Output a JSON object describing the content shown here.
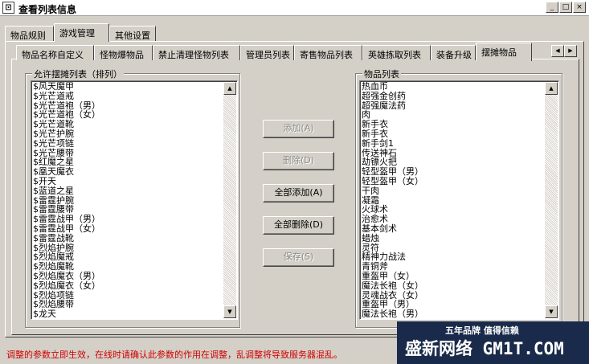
{
  "window": {
    "title": "查看列表信息",
    "icon": "app-window-icon",
    "minimize_glyph": "_",
    "maximize_glyph": "□",
    "close_glyph": "×"
  },
  "outer_tabs": [
    "物品规则",
    "游戏管理",
    "其他设置"
  ],
  "inner_tabs": [
    "物品名称自定义",
    "怪物爆物品",
    "禁止清理怪物列表",
    "管理员列表",
    "寄售物品列表",
    "英雄拣取列表",
    "装备升级",
    "摆摊物品"
  ],
  "tab_scroll": {
    "left_glyph": "◀",
    "right_glyph": "▶"
  },
  "scroll_glyphs": {
    "up": "▲",
    "down": "▼"
  },
  "left_group": {
    "label": "允许摆摊列表（排列）",
    "items": [
      "$风天魔甲",
      "$光芒道戒",
      "$光芒道袍（男）",
      "$光芒道袍（女）",
      "$光芒道靴",
      "$光芒护腕",
      "$光芒项链",
      "$光芒腰带",
      "$红魔之星",
      "$凰天魔衣",
      "$开天",
      "$蓝道之星",
      "$雷霆护腕",
      "$雷霆腰带",
      "$雷霆战甲（男）",
      "$雷霆战甲（女）",
      "$雷霆战靴",
      "$烈焰护腕",
      "$烈焰魔戒",
      "$烈焰魔靴",
      "$烈焰魔衣（男）",
      "$烈焰魔衣（女）",
      "$烈焰项链",
      "$烈焰腰带",
      "$龙天"
    ]
  },
  "right_group": {
    "label": "物品列表",
    "items": [
      "热血币",
      "超强金创药",
      "超强魔法药",
      "肉",
      "新手衣",
      "新手衣",
      "新手剑1",
      "传送神石",
      "劫镖火把",
      "轻型盔甲（男）",
      "轻型盔甲（女）",
      "干肉",
      "凝霜",
      "火球术",
      "治愈术",
      "基本剑术",
      "蜡烛",
      "灵符",
      "精神力战法",
      "青铜斧",
      "重盔甲（女）",
      "魔法长袍（女）",
      "灵魂战衣（女）",
      "重盔甲（男）",
      "魔法长袍（男）"
    ]
  },
  "buttons": {
    "add": "添加(A)",
    "remove": "删除(D)",
    "add_all": "全部添加(A)",
    "remove_all": "全部删除(D)",
    "save": "保存(S)"
  },
  "status_text": "调整的参数立即生效，在线时请确认此参数的作用在调整，乱调整将导致服务器混乱。",
  "watermark": {
    "tagline": "五年品牌 值得信赖",
    "brand": "盛新网络 GM1T.COM"
  },
  "colors": {
    "face": "#d4d0c8",
    "status": "#d00000",
    "watermark_bg": "#1a2a4a"
  }
}
